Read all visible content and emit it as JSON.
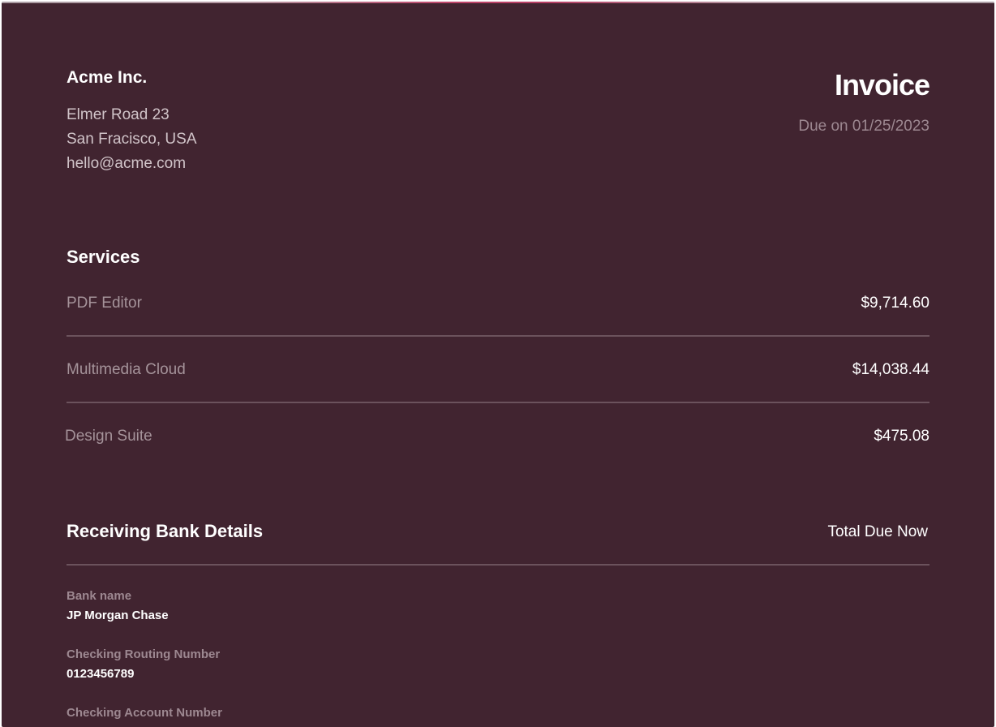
{
  "company": {
    "name": "Acme Inc.",
    "address_line1": "Elmer Road 23",
    "address_line2": "San Fracisco, USA",
    "email": "hello@acme.com"
  },
  "invoice": {
    "title": "Invoice",
    "due": "Due on 01/25/2023"
  },
  "services": {
    "heading": "Services",
    "items": [
      {
        "name": "PDF Editor",
        "price": "$9,714.60"
      },
      {
        "name": "Multimedia Cloud",
        "price": "$14,038.44"
      },
      {
        "name": "Design Suite",
        "price": "$475.08"
      }
    ]
  },
  "bank": {
    "heading": "Receiving Bank Details",
    "total_label": "Total Due Now",
    "fields": [
      {
        "label": "Bank name",
        "value": "JP Morgan Chase"
      },
      {
        "label": "Checking Routing Number",
        "value": "0123456789"
      },
      {
        "label": "Checking Account Number",
        "value": ""
      }
    ]
  },
  "colors": {
    "background": "#412430",
    "accent": "#c0466b",
    "muted_text": "#9d8891"
  }
}
